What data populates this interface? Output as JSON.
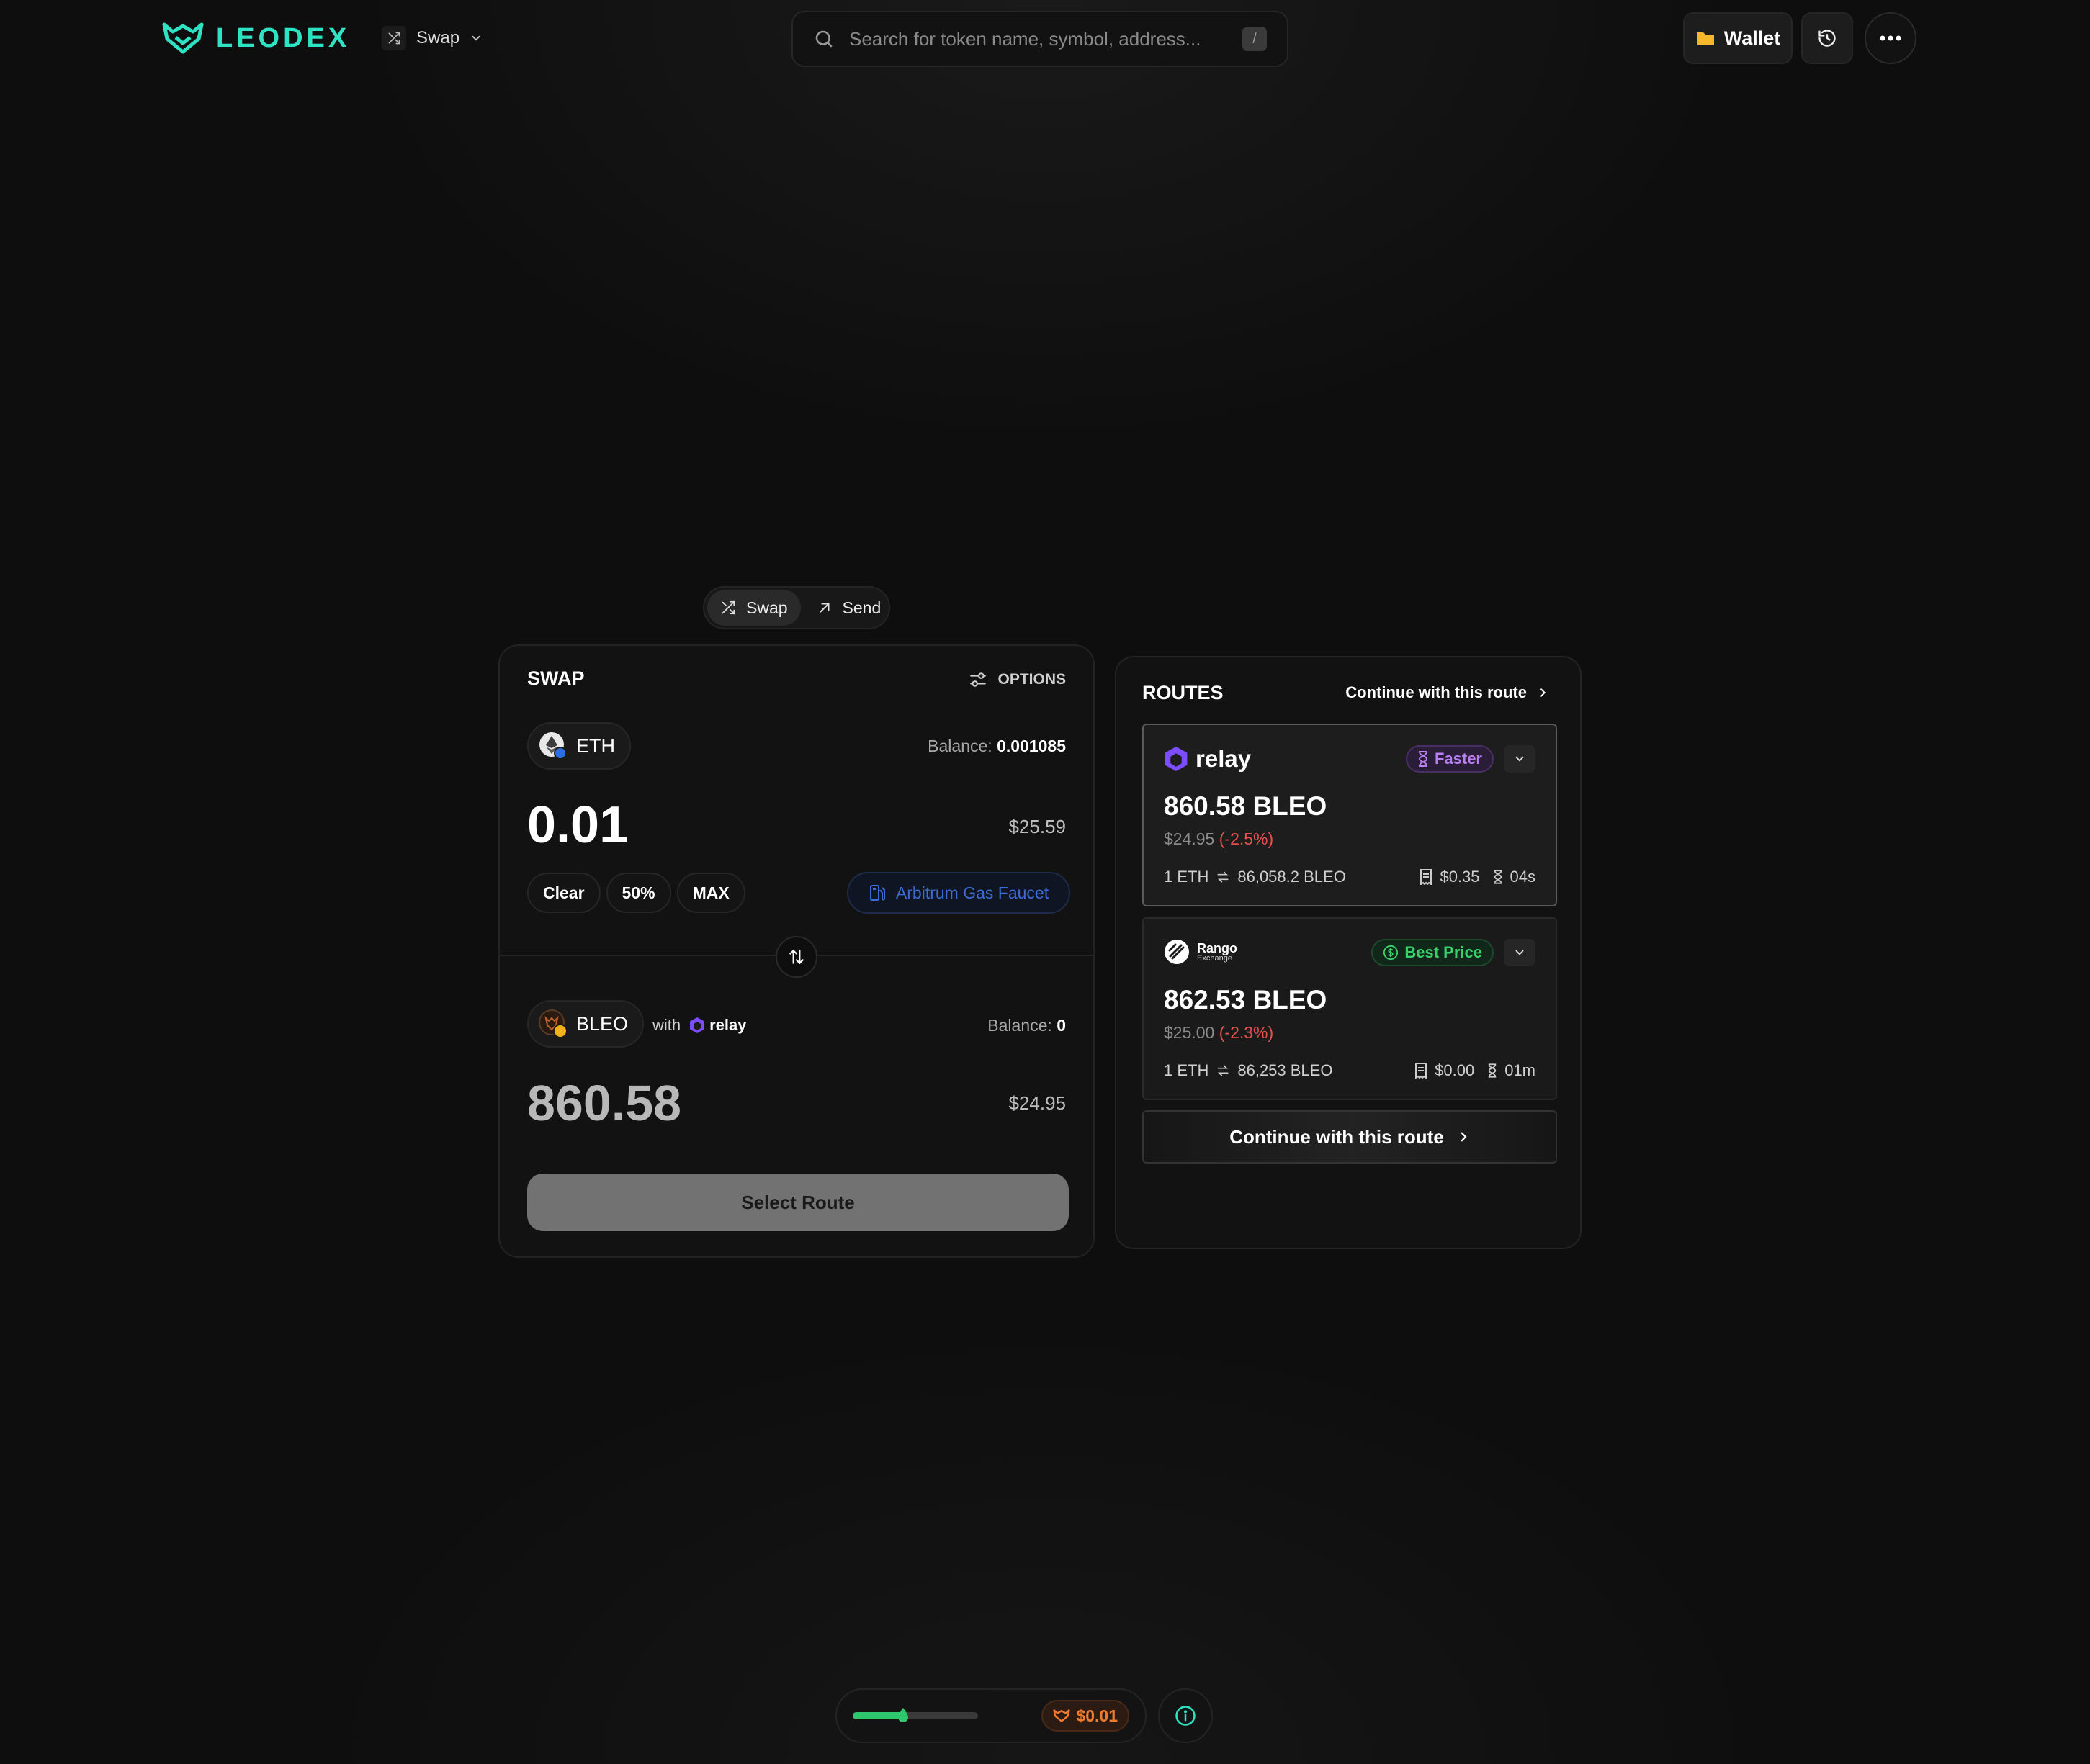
{
  "header": {
    "brand": "LEODEX",
    "mode_label": "Swap",
    "search": {
      "placeholder": "Search for token name, symbol, address...",
      "shortcut": "/"
    },
    "wallet_label": "Wallet"
  },
  "tabs": [
    {
      "label": "Swap",
      "active": true
    },
    {
      "label": "Send",
      "active": false
    }
  ],
  "swap": {
    "title": "SWAP",
    "options_label": "OPTIONS",
    "from": {
      "symbol": "ETH",
      "balance_label": "Balance:",
      "balance": "0.001085",
      "amount": "0.01",
      "usd": "$25.59"
    },
    "quick": {
      "clear": "Clear",
      "half": "50%",
      "max": "MAX"
    },
    "faucet_label": "Arbitrum Gas Faucet",
    "to": {
      "symbol": "BLEO",
      "with_label": "with",
      "provider": "relay",
      "balance_label": "Balance:",
      "balance": "0",
      "amount": "860.58",
      "usd": "$24.95"
    },
    "select_route_label": "Select Route"
  },
  "routes": {
    "title": "ROUTES",
    "continue_label": "Continue with this route",
    "items": [
      {
        "provider": "relay",
        "badge": "Faster",
        "amount": "860.58 BLEO",
        "usd": "$24.95",
        "change": "(-2.5%)",
        "rate_from": "1 ETH",
        "rate_to": "86,058.2 BLEO",
        "fee": "$0.35",
        "time": "04s",
        "selected": true
      },
      {
        "provider": "Rango",
        "provider_sub": "Exchange",
        "badge": "Best Price",
        "amount": "862.53 BLEO",
        "usd": "$25.00",
        "change": "(-2.3%)",
        "rate_from": "1 ETH",
        "rate_to": "86,253 BLEO",
        "fee": "$0.00",
        "time": "01m",
        "selected": false
      }
    ],
    "continue_button": "Continue with this route"
  },
  "footer": {
    "gas_level": 0.4,
    "price": "$0.01"
  },
  "colors": {
    "brand": "#2ee3c3",
    "faster": "#b97ef0",
    "best": "#3ad06a",
    "negative": "#e2524f",
    "price": "#f07a2e",
    "gas": "#2fc76d",
    "relay": "#7b4dff"
  },
  "icons": [
    "leodex-logo-icon",
    "shuffle-icon",
    "chevron-down-icon",
    "search-icon",
    "folder-icon",
    "history-icon",
    "more-icon",
    "arrow-up-right-icon",
    "sliders-icon",
    "eth-icon",
    "bleo-icon",
    "gas-pump-icon",
    "swap-vertical-icon",
    "relay-icon",
    "rango-icon",
    "hourglass-icon",
    "dollar-circle-icon",
    "receipt-icon",
    "arrows-exchange-icon",
    "chevron-right-icon",
    "droplet-icon",
    "leodex-small-icon",
    "info-icon"
  ]
}
